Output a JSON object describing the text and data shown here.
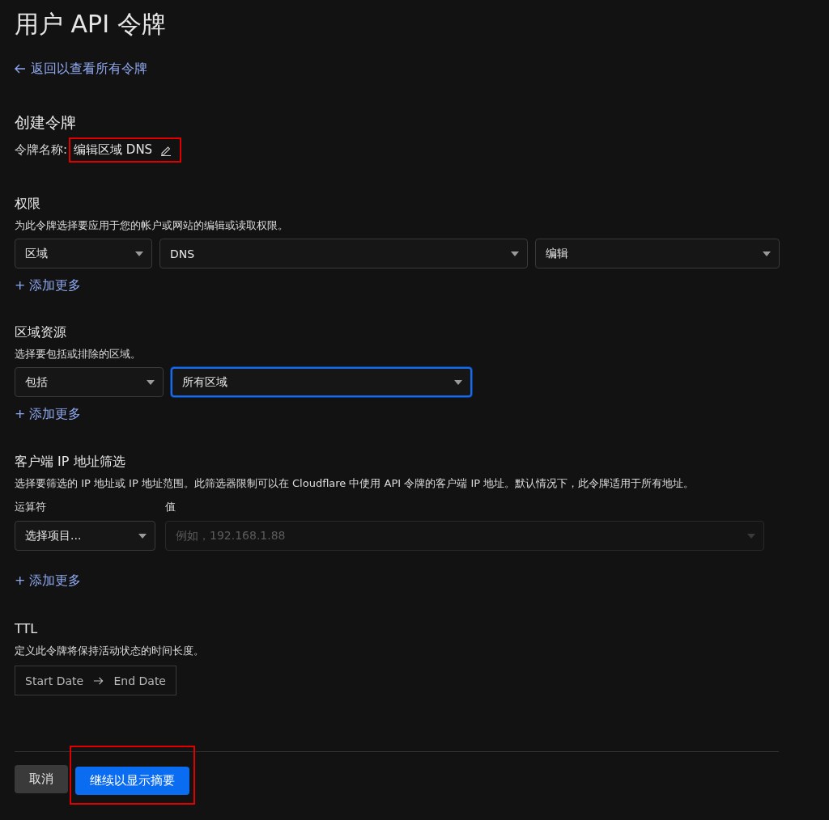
{
  "page_title": "用户 API 令牌",
  "back_link": {
    "label": "返回以查看所有令牌"
  },
  "create_token": {
    "heading": "创建令牌",
    "name_label": "令牌名称:",
    "name_value": "编辑区域 DNS",
    "highlighted": true
  },
  "permissions": {
    "heading": "权限",
    "description": "为此令牌选择要应用于您的帐户或网站的编辑或读取权限。",
    "selects": [
      {
        "value": "区域",
        "focused": false
      },
      {
        "value": "DNS",
        "focused": false
      },
      {
        "value": "编辑",
        "focused": false
      }
    ],
    "add_more": "+ 添加更多"
  },
  "zone_resources": {
    "heading": "区域资源",
    "description": "选择要包括或排除的区域。",
    "selects": [
      {
        "value": "包括",
        "focused": false
      },
      {
        "value": "所有区域",
        "focused": true
      }
    ],
    "add_more": "+ 添加更多"
  },
  "client_ip_filter": {
    "heading": "客户端 IP 地址筛选",
    "description": "选择要筛选的 IP 地址或 IP 地址范围。此筛选器限制可以在 Cloudflare 中使用 API 令牌的客户端 IP 地址。默认情况下，此令牌适用于所有地址。",
    "operator_label": "运算符",
    "value_label": "值",
    "operator_select": {
      "value": "选择项目...",
      "disabled": false
    },
    "value_select": {
      "placeholder": "例如，192.168.1.88",
      "disabled": true
    },
    "add_more": "+ 添加更多"
  },
  "ttl": {
    "heading": "TTL",
    "description": "定义此令牌将保持活动状态的时间长度。",
    "start_placeholder": "Start Date",
    "end_placeholder": "End Date"
  },
  "buttons": [
    {
      "label": "取消",
      "kind": "secondary",
      "highlighted": false
    },
    {
      "label": "继续以显示摘要",
      "kind": "primary",
      "highlighted": true
    }
  ]
}
